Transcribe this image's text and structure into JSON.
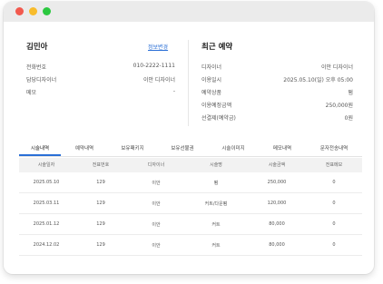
{
  "customer": {
    "name": "김민아",
    "edit_link": "정보변경",
    "fields": [
      {
        "label": "전화번호",
        "value": "010-2222-1111"
      },
      {
        "label": "담당디자이너",
        "value": "이안 디자이너"
      },
      {
        "label": "메모",
        "value": "-"
      }
    ]
  },
  "recent_booking": {
    "title": "최근 예약",
    "fields": [
      {
        "label": "디자이너",
        "value": "이안 디자이너"
      },
      {
        "label": "이용일시",
        "value": "2025.05.10(일) 오후 05:00"
      },
      {
        "label": "예약상품",
        "value": "펌"
      },
      {
        "label": "이용예정금액",
        "value": "250,000원"
      },
      {
        "label": "선결제(예약금)",
        "value": "0원"
      }
    ]
  },
  "tabs": [
    "시술내역",
    "예약내역",
    "보유패키지",
    "보유선불권",
    "시술이미지",
    "메모내역",
    "문자전송내역"
  ],
  "table": {
    "columns": [
      "시술일자",
      "전표번호",
      "디자이너",
      "시술명",
      "시술금액",
      "전표메모"
    ],
    "rows": [
      [
        "2025.05.10",
        "129",
        "이안",
        "펌",
        "250,000",
        "0"
      ],
      [
        "2025.03.11",
        "129",
        "이안",
        "커트/다운펌",
        "120,000",
        "0"
      ],
      [
        "2025.01.12",
        "129",
        "이안",
        "커트",
        "80,000",
        "0"
      ],
      [
        "2024.12.02",
        "129",
        "이안",
        "커트",
        "80,000",
        "0"
      ]
    ]
  }
}
